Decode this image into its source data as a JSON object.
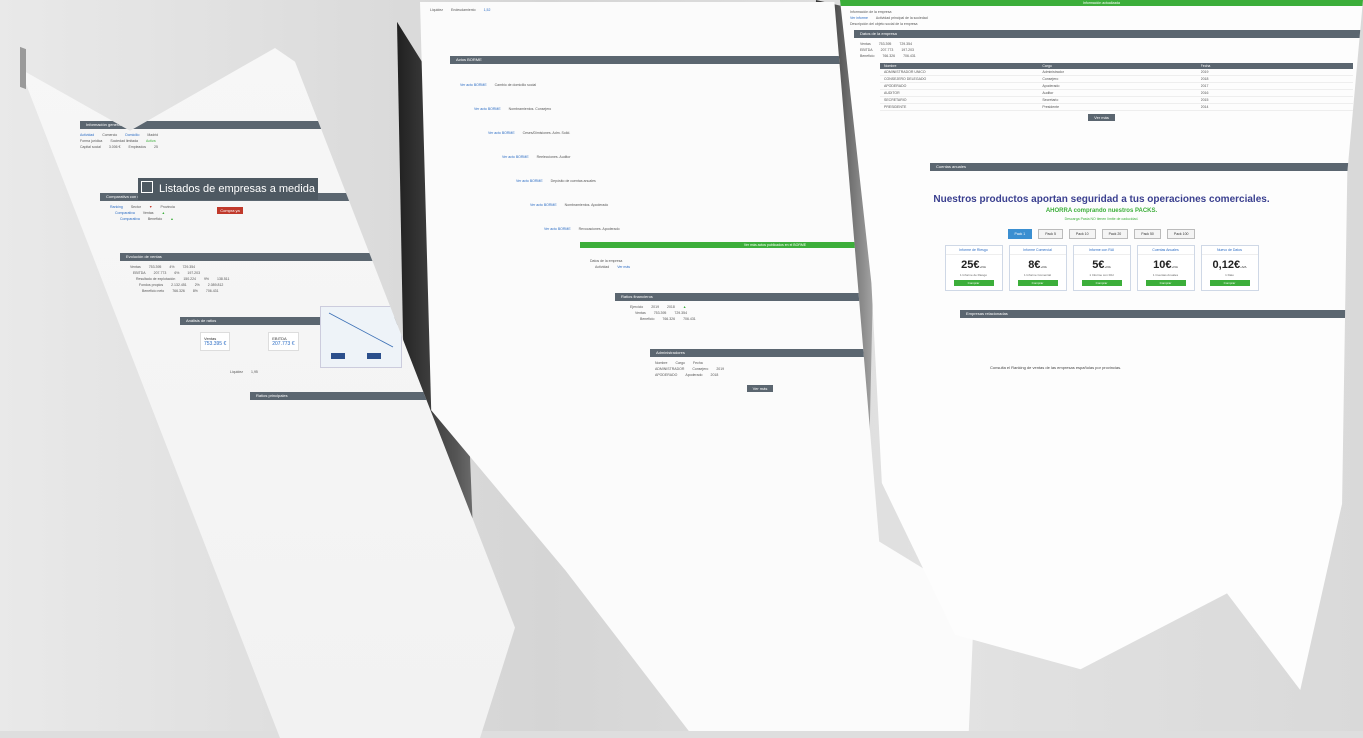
{
  "left_panel": {
    "banner_text": "Listados de empresas a medida",
    "banner_button": "Compra ya",
    "section_bars": [
      "Información general",
      "Comparativa con el sector",
      "Evolución de ventas",
      "Análisis de ratios",
      "Ratios principales"
    ],
    "table_rows": [
      {
        "label": "Ventas",
        "v1": "753.395",
        "v2": "4%",
        "v3": "729.354"
      },
      {
        "label": "EBITDA",
        "v1": "207.773",
        "v2": "6%",
        "v3": "197.203"
      },
      {
        "label": "Resultado de explotación",
        "v1": "150.224",
        "v2": "9%",
        "v3": "138.511"
      },
      {
        "label": "Fondos propios",
        "v1": "2.132.451",
        "v2": "2%",
        "v3": "2.089.812"
      },
      {
        "label": "Beneficio neto",
        "v1": "766.326",
        "v2": "8%",
        "v3": "706.431"
      }
    ],
    "stat_cards": [
      {
        "title": "Ventas",
        "value": "753.395 €"
      },
      {
        "title": "EBITDA",
        "value": "207.773 €"
      },
      {
        "title": "Beneficio neto",
        "value": "766.326 €"
      }
    ],
    "liquidity": {
      "title": "Liquidez",
      "value": "1,95"
    }
  },
  "middle_panel": {
    "top_title": "Endeudamiento",
    "top_value": "1,52",
    "entries": [
      {
        "link": "Ver acto BORME",
        "text": "Cambio de domicilio social"
      },
      {
        "link": "Ver acto BORME",
        "text": "Nombramientos. Consejero"
      },
      {
        "link": "Ver acto BORME",
        "text": "Ceses/Dimisiones. Adm. Solid."
      },
      {
        "link": "Ver acto BORME",
        "text": "Reelecciones. Auditor"
      },
      {
        "link": "Ver acto BORME",
        "text": "Depósito de cuentas anuales"
      },
      {
        "link": "Ver acto BORME",
        "text": "Nombramientos. Apoderado"
      },
      {
        "link": "Ver acto BORME",
        "text": "Revocaciones. Apoderado"
      }
    ],
    "green_bar": "Ver más actos publicados en el BORME",
    "bottom_bar": "Ratios financieros",
    "button": "Ver más"
  },
  "right_panel": {
    "top_green": "Información actualizada",
    "promo_title": "Nuestros productos aportan seguridad a tus operaciones comerciales.",
    "promo_sub": "AHORRA comprando nuestros PACKS.",
    "promo_note": "Descarga Pasta NO tienen límite de caducidad.",
    "tabs": [
      "Pack 1",
      "Pack 5",
      "Pack 10",
      "Pack 20",
      "Pack 50",
      "Pack 100"
    ],
    "cards": [
      {
        "title": "Informe de Riesgo",
        "price": "25€",
        "unit": "+IVA",
        "desc": "1 Informe de Riesgo",
        "button": "Comprar"
      },
      {
        "title": "Informe Comercial",
        "price": "8€",
        "unit": "+IVA",
        "desc": "1 Informe Comercial",
        "button": "Comprar"
      },
      {
        "title": "Informe con RAI",
        "price": "5€",
        "unit": "+IVA",
        "desc": "1 Informe con RAI",
        "button": "Comprar"
      },
      {
        "title": "Cuentas Anuales",
        "price": "10€",
        "unit": "+IVA",
        "desc": "1 Cuentas Anuales",
        "button": "Comprar"
      },
      {
        "title": "Nuevo de Datos",
        "price": "0,12€",
        "unit": "+IVA",
        "desc": "1 Dato",
        "button": "Comprar"
      }
    ],
    "table_header": [
      "Nombre",
      "Cargo",
      "Fecha"
    ],
    "table_rows": [
      [
        "ADMINISTRADOR UNICO",
        "Administrador",
        "2019"
      ],
      [
        "CONSEJERO DELEGADO",
        "Consejero",
        "2018"
      ],
      [
        "APODERADO",
        "Apoderado",
        "2017"
      ],
      [
        "AUDITOR",
        "Auditor",
        "2016"
      ],
      [
        "SECRETARIO",
        "Secretario",
        "2015"
      ],
      [
        "PRESIDENTE",
        "Presidente",
        "2014"
      ]
    ],
    "button": "Ver más",
    "footer": "Consulta el Ranking de ventas de las empresas españolas por provincias."
  }
}
